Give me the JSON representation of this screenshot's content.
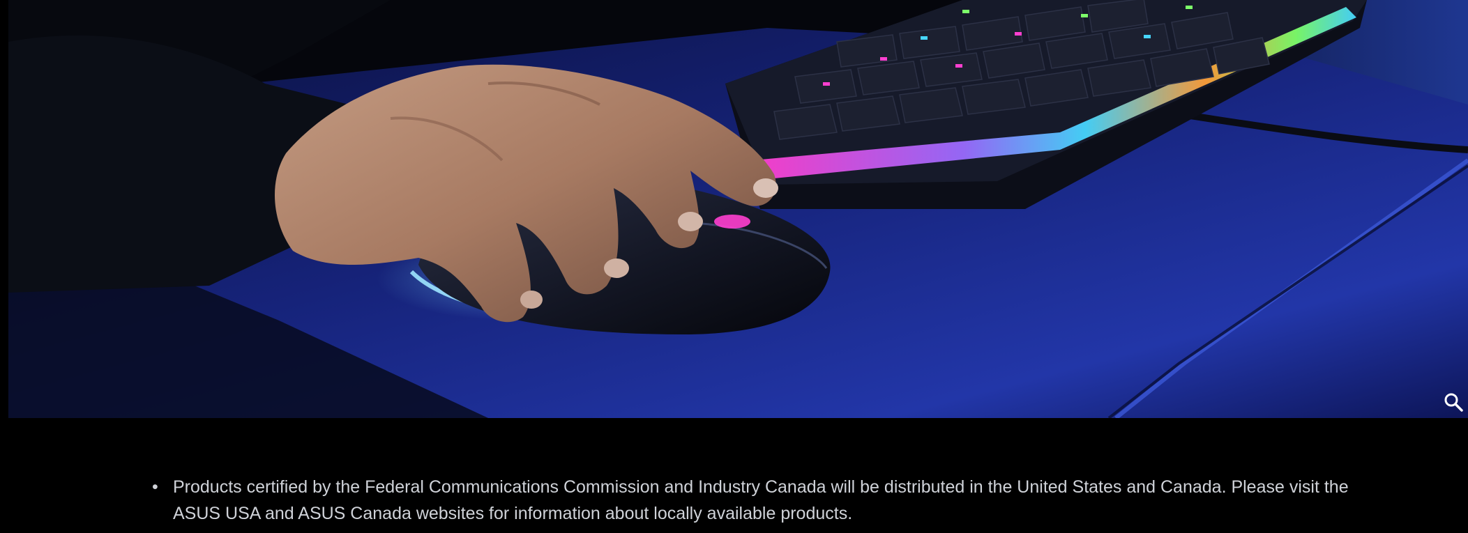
{
  "hero": {
    "image_alt": "ROG mouse and RGB keyboard on blue desk mat",
    "zoom_icon": "magnifier-icon"
  },
  "notes": {
    "items": [
      {
        "bullet": "•",
        "text": "Products certified by the Federal Communications Commission and Industry Canada will be distributed in the United States and Canada. Please visit the ASUS USA and ASUS Canada websites for information about locally available products."
      }
    ]
  },
  "colors": {
    "page_background": "#000000",
    "note_text": "#cfd2d8",
    "mat_blue": "#1f2f8a",
    "rgb_pink": "#ff3fd0",
    "rgb_cyan": "#47d6ff"
  }
}
